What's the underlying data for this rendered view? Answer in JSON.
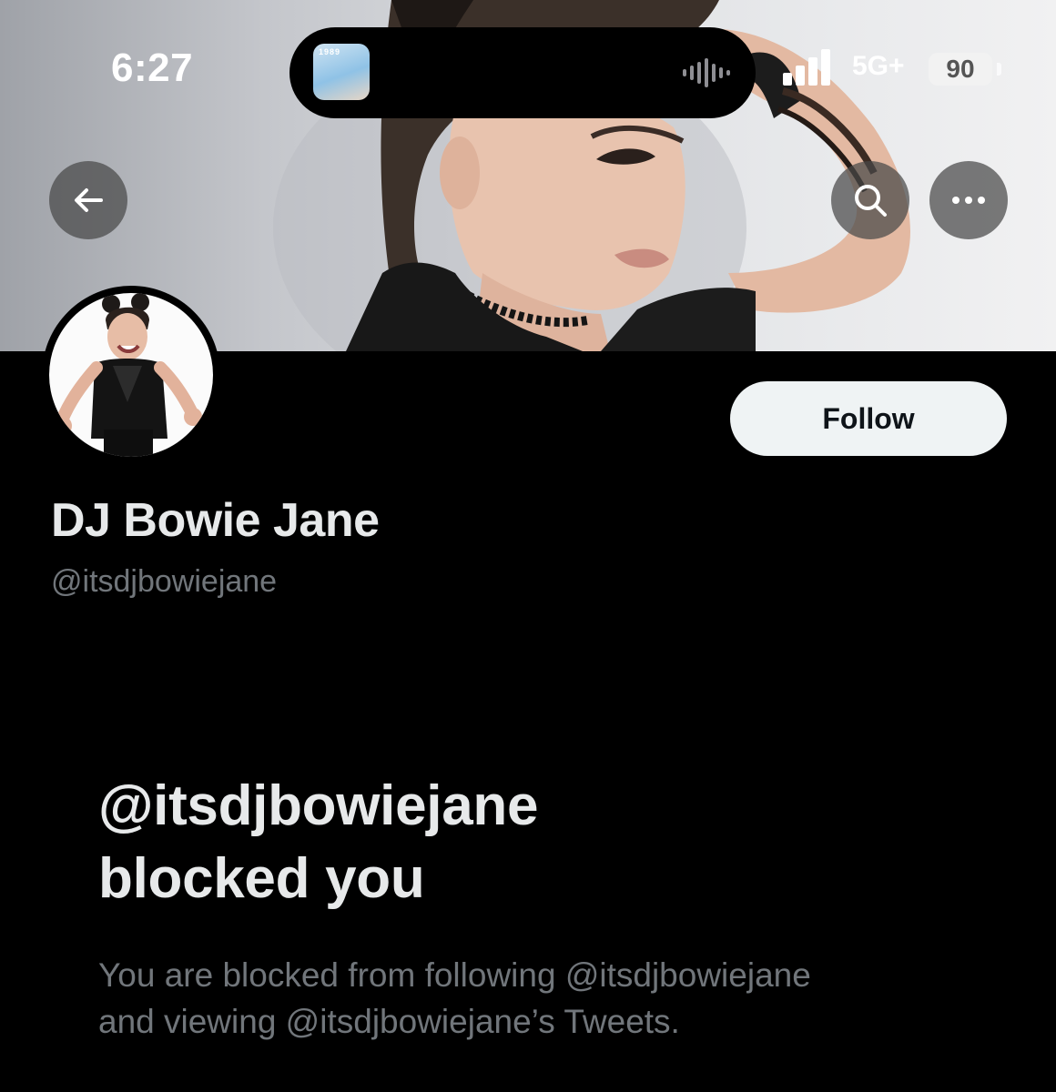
{
  "status_bar": {
    "time": "6:27",
    "network": "5G+",
    "battery": "90",
    "now_playing_art_text": "1989"
  },
  "header": {
    "back_icon": "arrow-left-icon",
    "search_icon": "search-icon",
    "more_icon": "more-horizontal-icon"
  },
  "profile": {
    "display_name": "DJ Bowie Jane",
    "handle": "@itsdjbowiejane",
    "follow_label": "Follow"
  },
  "blocked": {
    "title_line1": "@itsdjbowiejane",
    "title_line2": "blocked you",
    "desc_line1": "You are blocked from following @itsdjbowiejane",
    "desc_line2": "and viewing @itsdjbowiejane’s Tweets."
  },
  "colors": {
    "background": "#000000",
    "primary_text": "#e7e9ea",
    "secondary_text": "#71767b",
    "follow_button_bg": "#eff3f4"
  }
}
